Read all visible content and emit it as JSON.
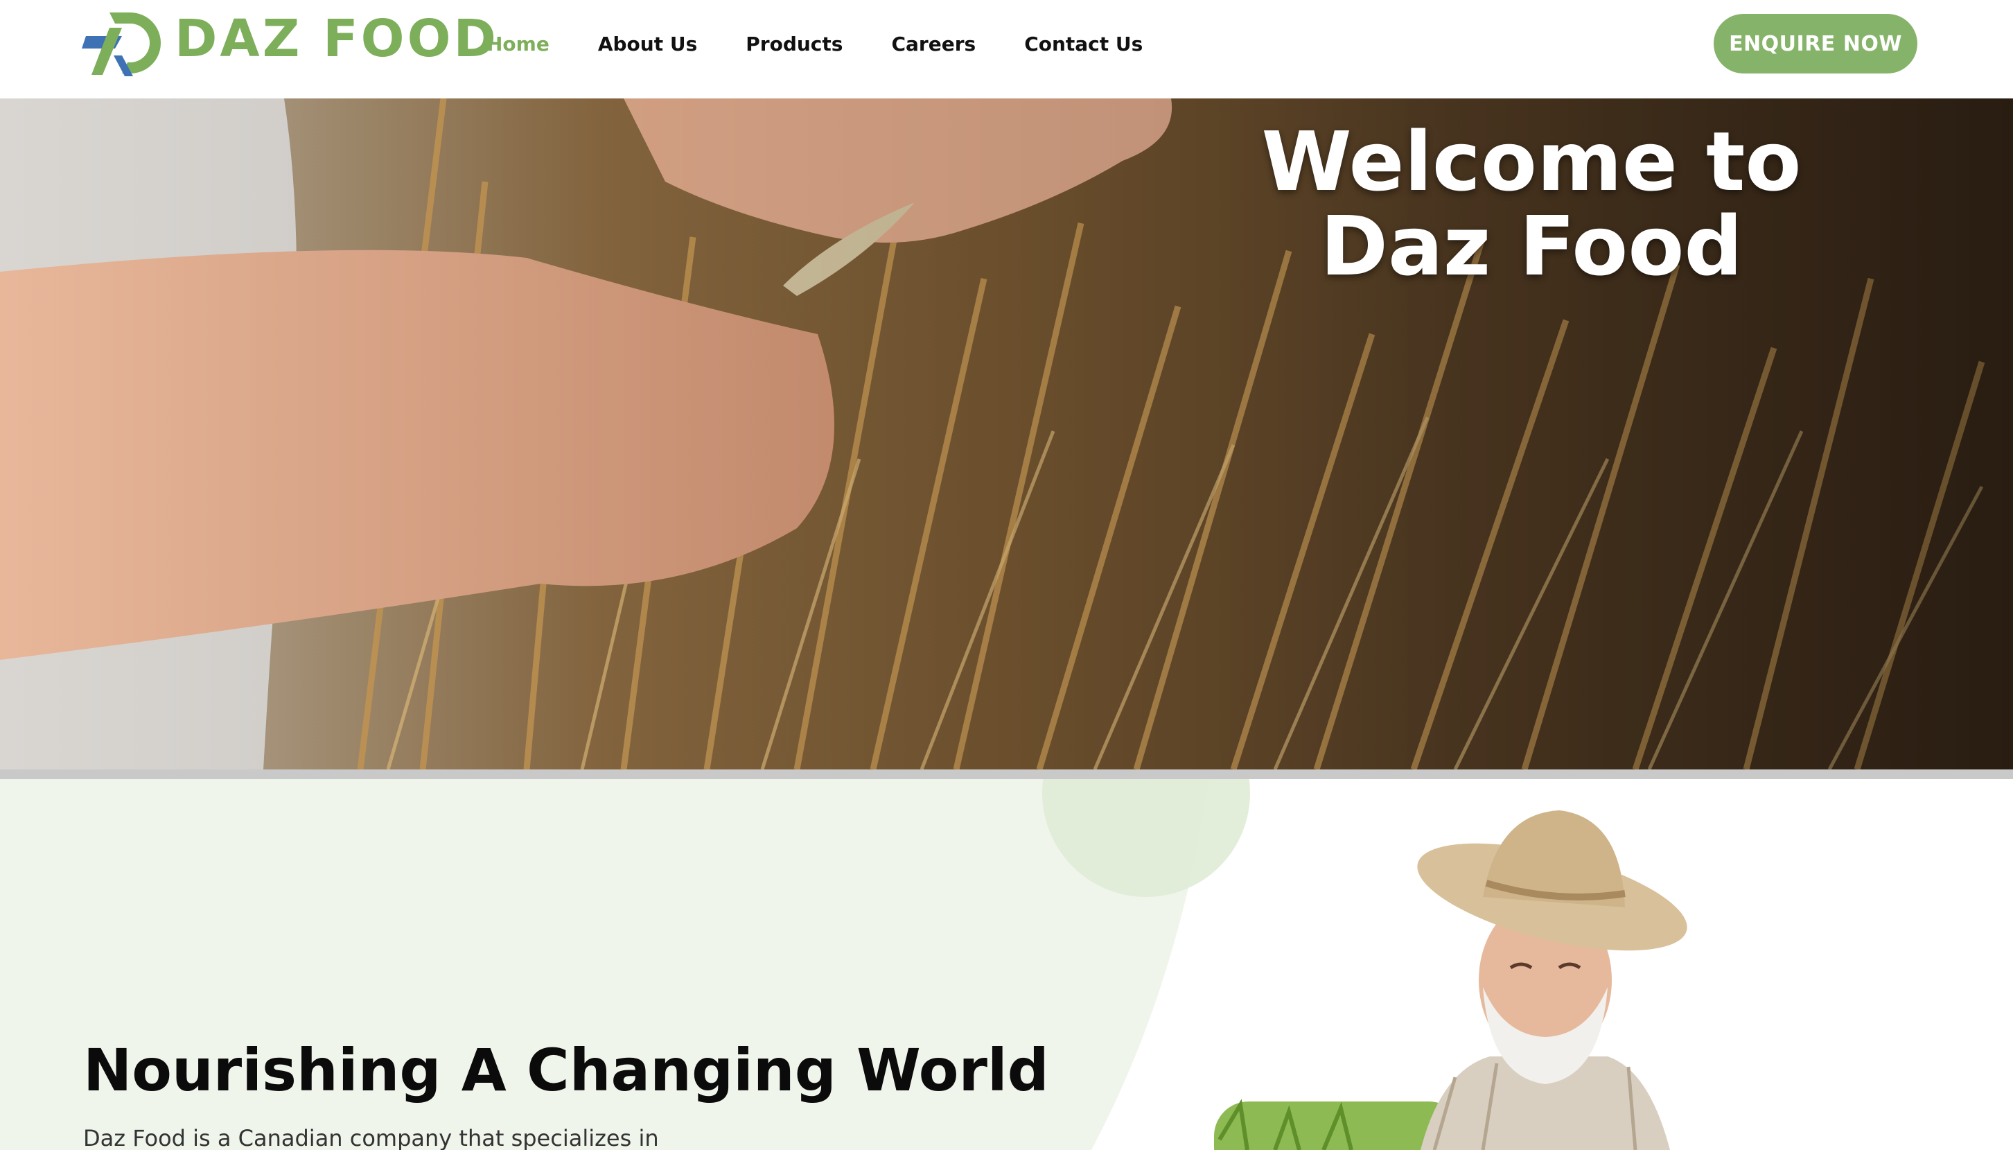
{
  "header": {
    "logo_text": "DAZ FOOD",
    "nav": [
      {
        "label": "Home",
        "active": true
      },
      {
        "label": "About Us",
        "active": false
      },
      {
        "label": "Products",
        "active": false
      },
      {
        "label": "Careers",
        "active": false
      },
      {
        "label": "Contact Us",
        "active": false
      }
    ],
    "cta_label": "ENQUIRE NOW"
  },
  "hero": {
    "title_line1": "Welcome to",
    "title_line2": "Daz Food"
  },
  "about": {
    "heading": "Nourishing A Changing World",
    "text": "Daz Food is a Canadian company that specializes in"
  },
  "colors": {
    "brand_green": "#7dae5a",
    "brand_blue": "#3f72b5",
    "button_green": "#86b36a",
    "pale_green": "#f0f5ec"
  }
}
